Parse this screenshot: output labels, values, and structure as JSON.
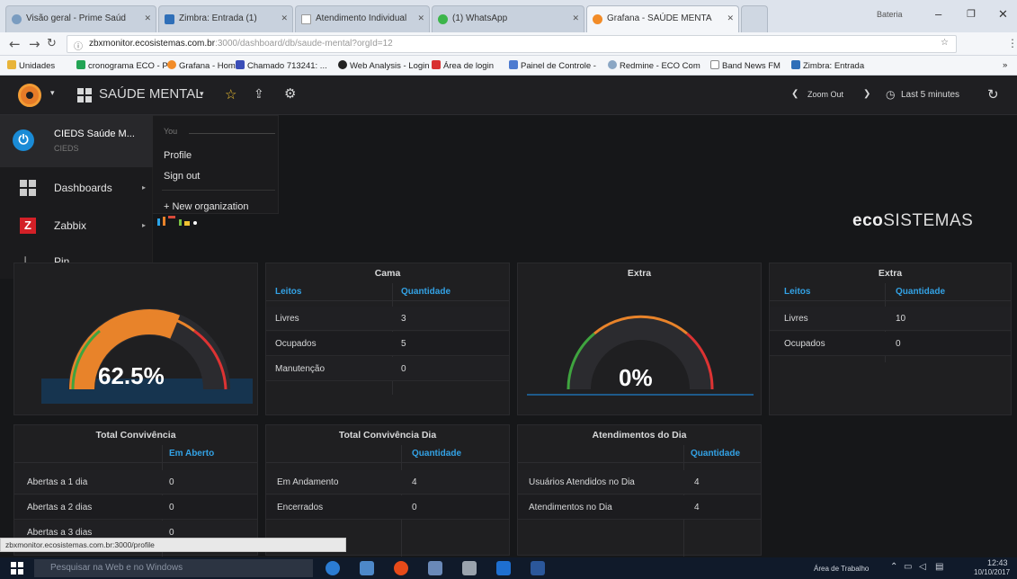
{
  "browser": {
    "tabs": [
      {
        "label": "Visão geral - Prime Saúd",
        "active": false
      },
      {
        "label": "Zimbra: Entrada (1)",
        "active": false
      },
      {
        "label": "Atendimento Individual",
        "active": false
      },
      {
        "label": "(1) WhatsApp",
        "active": false
      },
      {
        "label": "Grafana - SAÚDE MENTA",
        "active": true
      }
    ],
    "profile_label": "Bateria",
    "url_host": "zbxmonitor.ecosistemas.com.br",
    "url_path": ":3000/dashboard/db/saude-mental?orgId=12",
    "bookmarks": [
      "Unidades",
      "cronograma ECO - P",
      "Grafana - Home",
      "Chamado 713241: ...",
      "Web Analysis - Login",
      "Área de login",
      "Painel de Controle -",
      "Redmine - ECO Com",
      "Band News FM",
      "Zimbra: Entrada"
    ]
  },
  "grafana": {
    "dashboard_title": "SAÚDE MENTAL",
    "zoom_out": "Zoom Out",
    "time_range": "Last 5 minutes",
    "org_name": "CIEDS Saúde M...",
    "org_sub": "CIEDS",
    "sidebar": [
      "Dashboards",
      "Zabbix",
      "Pin"
    ],
    "submenu_header": "You",
    "submenu": [
      "Profile",
      "Sign out"
    ],
    "new_org": "+ New organization",
    "brand_eco": "eco",
    "brand_rest": "SISTEMAS",
    "panels": {
      "gauge1": {
        "value": "62.5%",
        "fraction": 0.625
      },
      "cama": {
        "title": "Cama",
        "col1": "Leitos",
        "col2": "Quantidade",
        "rows": [
          [
            "Livres",
            "3"
          ],
          [
            "Ocupados",
            "5"
          ],
          [
            "Manutenção",
            "0"
          ]
        ]
      },
      "extra_gauge": {
        "title": "Extra",
        "value": "0%",
        "fraction": 0
      },
      "extra_table": {
        "title": "Extra",
        "col1": "Leitos",
        "col2": "Quantidade",
        "rows": [
          [
            "Livres",
            "10"
          ],
          [
            "Ocupados",
            "0"
          ]
        ]
      },
      "convivencia": {
        "title": "Total Convivência",
        "col2": "Em Aberto",
        "rows": [
          [
            "Abertas a 1 dia",
            "0"
          ],
          [
            "Abertas a 2 dias",
            "0"
          ],
          [
            "Abertas a 3 dias",
            "0"
          ]
        ]
      },
      "convivencia_dia": {
        "title": "Total Convivência Dia",
        "col2": "Quantidade",
        "rows": [
          [
            "Em Andamento",
            "4"
          ],
          [
            "Encerrados",
            "0"
          ]
        ]
      },
      "atendimentos": {
        "title": "Atendimentos do Dia",
        "col2": "Quantidade",
        "rows": [
          [
            "Usuários Atendidos no Dia",
            "4"
          ],
          [
            "Atendimentos no Dia",
            "4"
          ]
        ]
      }
    }
  },
  "statusbar": "zbxmonitor.ecosistemas.com.br:3000/profile",
  "taskbar": {
    "search_placeholder": "Pesquisar na Web e no Windows",
    "tray_label": "Área de Trabalho",
    "time": "12:43",
    "date": "10/10/2017"
  }
}
